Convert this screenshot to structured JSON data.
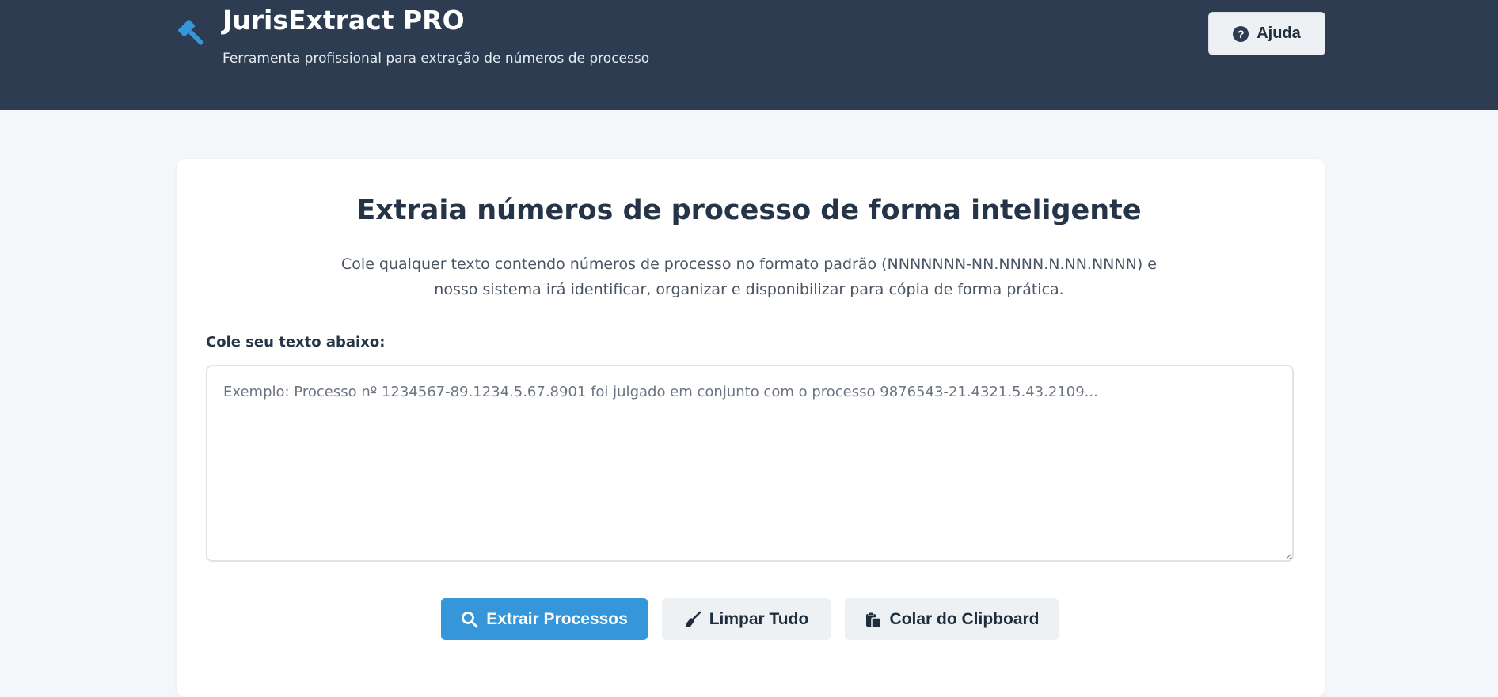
{
  "header": {
    "title": "JurisExtract PRO",
    "subtitle": "Ferramenta profissional para extração de números de processo",
    "logo_icon": "gavel-icon",
    "help_button": {
      "label": "Ajuda",
      "icon": "question-circle-icon"
    }
  },
  "main": {
    "heading": "Extraia números de processo de forma inteligente",
    "description_line1": "Cole qualquer texto contendo números de processo no formato padrão (NNNNNNN-NN.NNNN.N.NN.NNNN) e",
    "description_line2": "nosso sistema irá identificar, organizar e disponibilizar para cópia de forma prática.",
    "input_label": "Cole seu texto abaixo:",
    "input_placeholder": "Exemplo: Processo nº 1234567-89.1234.5.67.8901 foi julgado em conjunto com o processo 9876543-21.4321.5.43.2109...",
    "input_value": ""
  },
  "actions": {
    "extract": {
      "label": "Extrair Processos",
      "icon": "search-icon"
    },
    "clear": {
      "label": "Limpar Tudo",
      "icon": "broom-icon"
    },
    "paste": {
      "label": "Colar do Clipboard",
      "icon": "clipboard-icon"
    }
  },
  "colors": {
    "header_bg": "#2d3c50",
    "page_bg": "#f4f6f9",
    "accent": "#3596d9",
    "secondary_button_bg": "#edf1f4",
    "heading_text": "#253447"
  }
}
